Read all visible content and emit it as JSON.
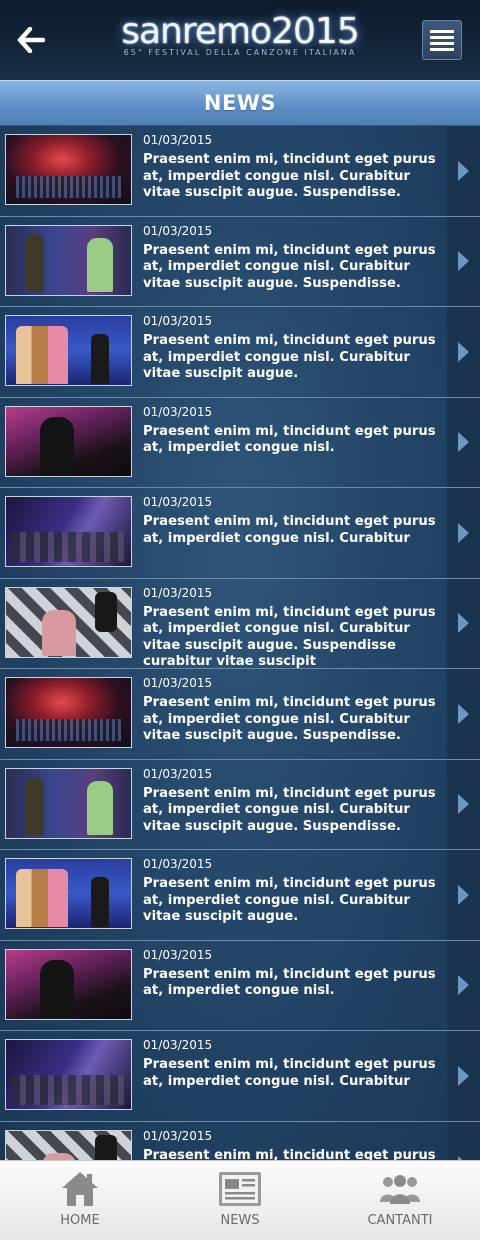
{
  "header": {
    "logo_main": "sanremo2015",
    "logo_sub": "65° FESTIVAL DELLA CANZONE ITALIANA",
    "back_icon": "back-arrow-icon",
    "menu_icon": "hamburger-menu-icon"
  },
  "section": {
    "title": "NEWS"
  },
  "news": [
    {
      "date": "01/03/2015",
      "text": "Praesent enim mi, tincidunt eget purus at, imperdiet congue nisl. Curabitur vitae suscipit augue. Suspendisse.",
      "thumb": "stage"
    },
    {
      "date": "01/03/2015",
      "text": "Praesent enim mi, tincidunt eget purus at, imperdiet congue nisl. Curabitur vitae suscipit augue. Suspendisse.",
      "thumb": "presenters"
    },
    {
      "date": "01/03/2015",
      "text": "Praesent enim mi, tincidunt eget purus at, imperdiet congue nisl. Curabitur vitae suscipit augue.",
      "thumb": "group"
    },
    {
      "date": "01/03/2015",
      "text": "Praesent enim mi, tincidunt eget purus at, imperdiet congue nisl.",
      "thumb": "singer"
    },
    {
      "date": "01/03/2015",
      "text": "Praesent enim mi, tincidunt eget purus at, imperdiet congue nisl. Curabitur",
      "thumb": "band"
    },
    {
      "date": "01/03/2015",
      "text": "Praesent enim mi, tincidunt eget purus at, imperdiet congue nisl. Curabitur vitae suscipit augue. Suspendisse curabitur vitae suscipit",
      "thumb": "checker"
    },
    {
      "date": "01/03/2015",
      "text": "Praesent enim mi, tincidunt eget purus at, imperdiet congue nisl. Curabitur vitae suscipit augue. Suspendisse.",
      "thumb": "stage"
    },
    {
      "date": "01/03/2015",
      "text": "Praesent enim mi, tincidunt eget purus at, imperdiet congue nisl. Curabitur vitae suscipit augue. Suspendisse.",
      "thumb": "presenters"
    },
    {
      "date": "01/03/2015",
      "text": "Praesent enim mi, tincidunt eget purus at, imperdiet congue nisl. Curabitur vitae suscipit augue.",
      "thumb": "group"
    },
    {
      "date": "01/03/2015",
      "text": "Praesent enim mi, tincidunt eget purus at, imperdiet congue nisl.",
      "thumb": "singer"
    },
    {
      "date": "01/03/2015",
      "text": "Praesent enim mi, tincidunt eget purus at, imperdiet congue nisl. Curabitur",
      "thumb": "band"
    },
    {
      "date": "01/03/2015",
      "text": "Praesent enim mi, tincidunt eget purus at,",
      "thumb": "checker"
    }
  ],
  "tabbar": {
    "items": [
      {
        "label": "HOME",
        "icon": "home-icon"
      },
      {
        "label": "NEWS",
        "icon": "newspaper-icon"
      },
      {
        "label": "CANTANTI",
        "icon": "people-icon"
      }
    ]
  },
  "colors": {
    "header_bg": "#14263b",
    "section_bar": "#5f90c6",
    "list_bg": "#244668",
    "arrow_col": "#1a3450",
    "arrow": "#6e98c4",
    "tabbar_bg": "#eeeeee",
    "tab_label": "#6a6a6a"
  }
}
